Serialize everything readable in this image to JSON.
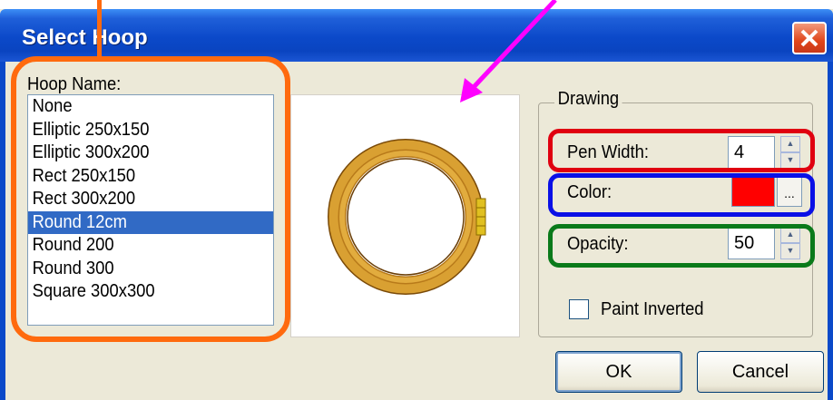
{
  "window": {
    "title": "Select Hoop",
    "close_icon": "close-icon"
  },
  "hoop_list": {
    "label": "Hoop Name:",
    "items": [
      "None",
      "Elliptic 250x150",
      "Elliptic 300x200",
      "Rect 250x150",
      "Rect 300x200",
      "Round 12cm",
      "Round 200",
      "Round 300",
      "Square 300x300"
    ],
    "selected": "Round 12cm"
  },
  "drawing": {
    "group_title": "Drawing",
    "pen_width": {
      "label": "Pen Width:",
      "value": "4"
    },
    "color": {
      "label": "Color:",
      "value": "#ff0000",
      "button_label": "..."
    },
    "opacity": {
      "label": "Opacity:",
      "value": "50"
    },
    "paint_inverted": {
      "label": "Paint Inverted",
      "checked": false
    }
  },
  "buttons": {
    "ok": "OK",
    "cancel": "Cancel"
  },
  "annotation_colors": {
    "orange": "#ff6a0e",
    "magenta": "#ff00ff",
    "red": "#e00010",
    "blue": "#0a10e6",
    "green": "#0a7a1a"
  }
}
